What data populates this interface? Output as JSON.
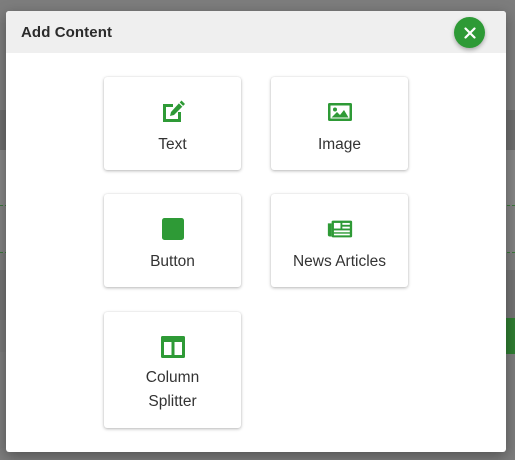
{
  "colors": {
    "accent": "#2e9a36",
    "header_bg": "#efefef",
    "title_text": "#2b2b2b",
    "tile_text": "#333333"
  },
  "modal": {
    "title": "Add Content",
    "close_icon": "close-icon"
  },
  "tiles": [
    {
      "label": "Text",
      "icon": "edit-icon"
    },
    {
      "label": "Image",
      "icon": "image-icon"
    },
    {
      "label": "Button",
      "icon": "button-icon"
    },
    {
      "label": "News Articles",
      "icon": "newspaper-icon"
    },
    {
      "label": "Column Splitter",
      "icon": "columns-icon"
    }
  ]
}
